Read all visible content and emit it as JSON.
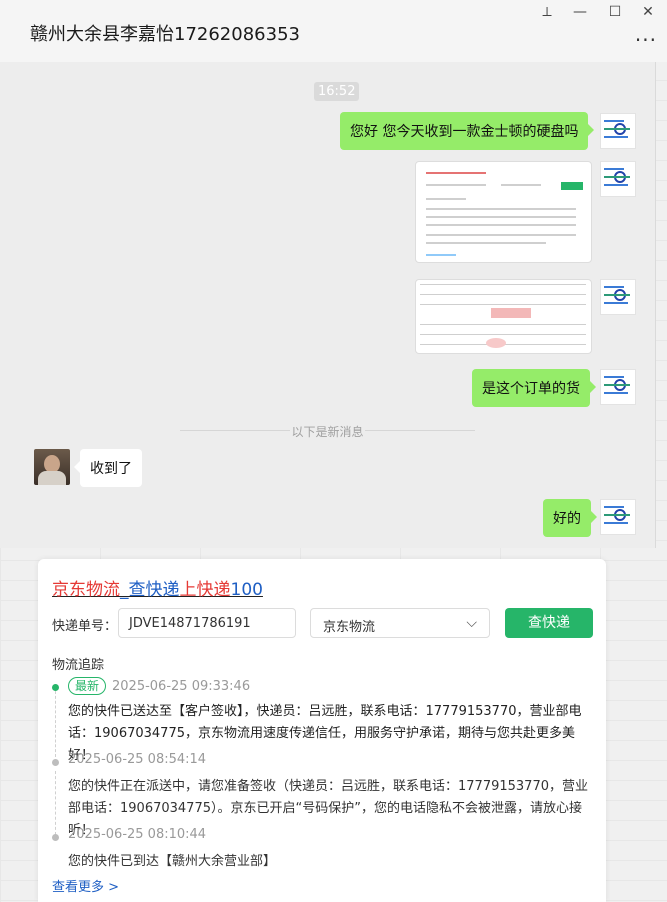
{
  "window": {
    "title": "赣州大余县李嘉怡17262086353",
    "controls": {
      "pin": "⟂",
      "minimize": "—",
      "maximize": "☐",
      "close": "✕"
    },
    "more": "···"
  },
  "chat": {
    "time": "16:52",
    "messages": [
      {
        "side": "right",
        "type": "text",
        "text": "您好 您今天收到一款金士顿的硬盘吗"
      },
      {
        "side": "right",
        "type": "image",
        "desc": "logistics-screenshot"
      },
      {
        "side": "right",
        "type": "image",
        "desc": "order-screenshot"
      },
      {
        "side": "right",
        "type": "text",
        "text": "是这个订单的货"
      },
      {
        "side": "left",
        "type": "text",
        "text": "收到了"
      },
      {
        "side": "right",
        "type": "text",
        "text": "好的"
      }
    ],
    "new_messages_divider": "以下是新消息"
  },
  "tracker": {
    "title_parts": [
      "京东物流",
      "_",
      "查快递",
      "上快递",
      "100"
    ],
    "number_label": "快递单号：",
    "number_value": "JDVE14871786191",
    "carrier_value": "京东物流",
    "search_button": "查快递",
    "section_title": "物流追踪",
    "latest_badge": "最新",
    "events": [
      {
        "time": "2025-06-25 09:33:46",
        "text": "您的快件已送达至【客户签收】，快递员：吕远胜，联系电话：17779153770，营业部电话：19067034775，京东物流用速度传递信任，用服务守护承诺，期待与您共赴更多美好！"
      },
      {
        "time": "2025-06-25 08:54:14",
        "text": "您的快件正在派送中，请您准备签收（快递员：吕远胜，联系电话：17779153770，营业部电话：19067034775）。京东已开启“号码保护”，您的电话隐私不会被泄露，请放心接听！"
      },
      {
        "time": "2025-06-25 08:10:44",
        "text": "您的快件已到达【赣州大余营业部】"
      }
    ],
    "more_link": "查看更多 >"
  },
  "colors": {
    "bubble_green": "#95ec69",
    "brand_red": "#e53935",
    "brand_blue": "#1f5fc4",
    "button_green": "#26b569"
  }
}
